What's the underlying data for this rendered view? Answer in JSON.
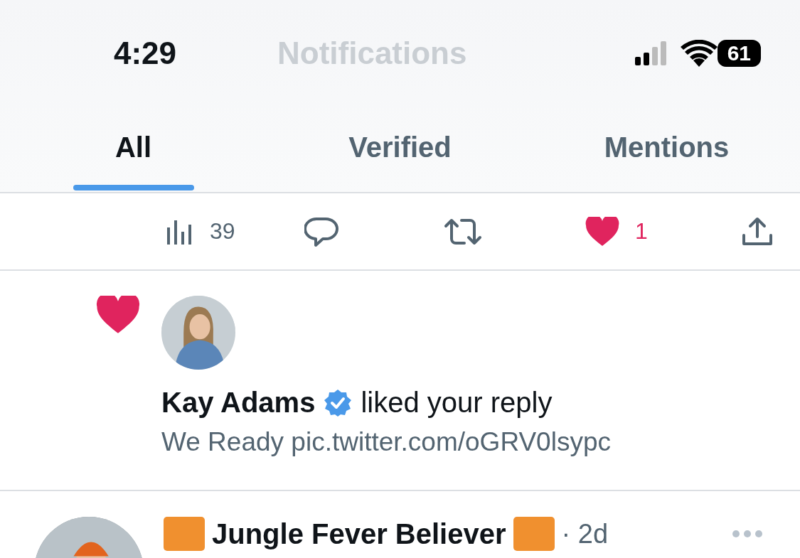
{
  "status_bar": {
    "time": "4:29",
    "battery": "61"
  },
  "header": {
    "title": "Notifications"
  },
  "tabs": [
    {
      "label": "All",
      "selected": true
    },
    {
      "label": "Verified",
      "selected": false
    },
    {
      "label": "Mentions",
      "selected": false
    }
  ],
  "action_bar": {
    "views": "39",
    "likes": "1",
    "liked": true
  },
  "notifications": [
    {
      "kind": "like",
      "user": "Kay Adams",
      "verified": true,
      "action": "liked your reply",
      "text": "We Ready pic.twitter.com/oGRV0lsypc"
    }
  ],
  "next_tweet": {
    "name": "Jungle Fever Believer",
    "time": "· 2d"
  }
}
